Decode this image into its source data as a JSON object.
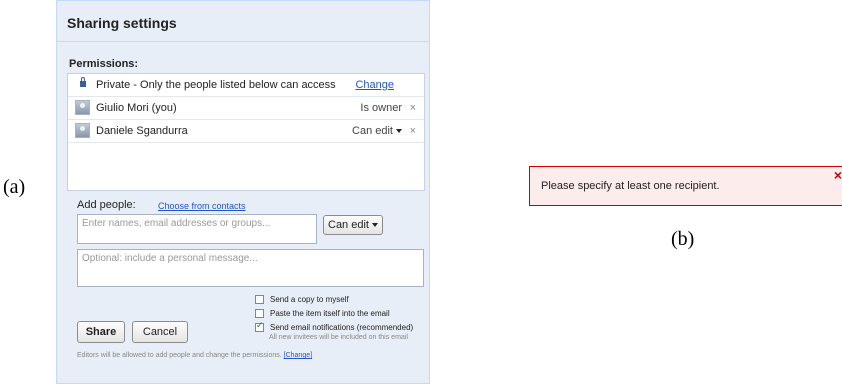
{
  "figure_labels": {
    "a": "(a)",
    "b": "(b)"
  },
  "dialog": {
    "title": "Sharing settings",
    "permissions_heading": "Permissions:",
    "rows": [
      {
        "name": "Private - Only the people listed below can access",
        "action": "Change"
      },
      {
        "name": "Giulio Mori (you)",
        "role": "Is owner",
        "remove": "×"
      },
      {
        "name": "Daniele Sgandurra",
        "role": "Can edit",
        "remove": "×"
      }
    ],
    "add_people": {
      "label": "Add people:",
      "choose_link": "Choose from contacts",
      "names_placeholder": "Enter names, email addresses or groups...",
      "permission_select": "Can edit",
      "message_placeholder": "Optional: include a personal message..."
    },
    "options": [
      {
        "label": "Send a copy to myself",
        "checked": false
      },
      {
        "label": "Paste the item itself into the email",
        "checked": false
      },
      {
        "label": "Send email notifications (recommended)",
        "checked": true
      }
    ],
    "options_note": "All new invitees will be included on this email",
    "share_button": "Share",
    "cancel_button": "Cancel",
    "footer_text": "Editors will be allowed to add people and change the permissions.",
    "footer_link": "[Change]"
  },
  "error": {
    "message": "Please specify at least one recipient.",
    "close": "×",
    "accent_color": "#cc0000"
  }
}
